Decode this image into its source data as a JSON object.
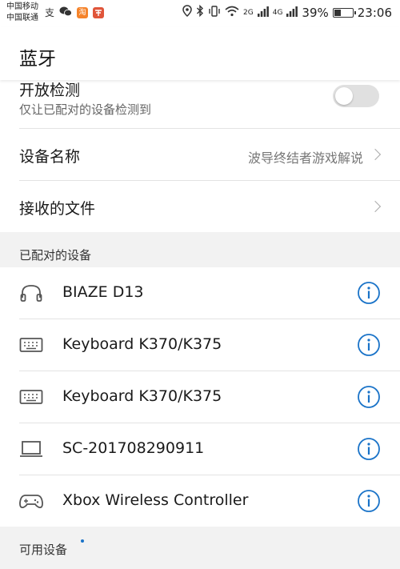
{
  "status_bar": {
    "carrier_1": "中国移动",
    "carrier_2": "中国联通",
    "notif_1": "支",
    "notif_3": "淘",
    "network_1": "2G",
    "network_2": "4G",
    "battery": "39%",
    "time": "23:06",
    "icons": [
      "alipay-icon",
      "wechat-icon",
      "taobao-icon",
      "app-icon",
      "location-icon",
      "bluetooth-icon",
      "vibrate-icon",
      "wifi-icon",
      "signal-icon",
      "battery-icon"
    ]
  },
  "header": {
    "title": "蓝牙"
  },
  "settings": {
    "open_detection": {
      "title": "开放检测",
      "subtitle": "仅让已配对的设备检测到",
      "enabled": false
    },
    "device_name": {
      "title": "设备名称",
      "value": "波导终结者游戏解说"
    },
    "received_files": {
      "title": "接收的文件"
    }
  },
  "paired": {
    "header": "已配对的设备",
    "devices": [
      {
        "name": "BIAZE D13",
        "icon": "headphones-icon"
      },
      {
        "name": "Keyboard K370/K375",
        "icon": "keyboard-icon"
      },
      {
        "name": "Keyboard K370/K375",
        "icon": "keyboard-icon"
      },
      {
        "name": "SC-201708290911",
        "icon": "laptop-icon"
      },
      {
        "name": "Xbox Wireless Controller",
        "icon": "gamepad-icon"
      }
    ]
  },
  "available": {
    "header": "可用设备"
  },
  "colors": {
    "accent": "#1a73c8",
    "toggle_off": "#e0e0e0",
    "background": "#f2f2f2"
  }
}
